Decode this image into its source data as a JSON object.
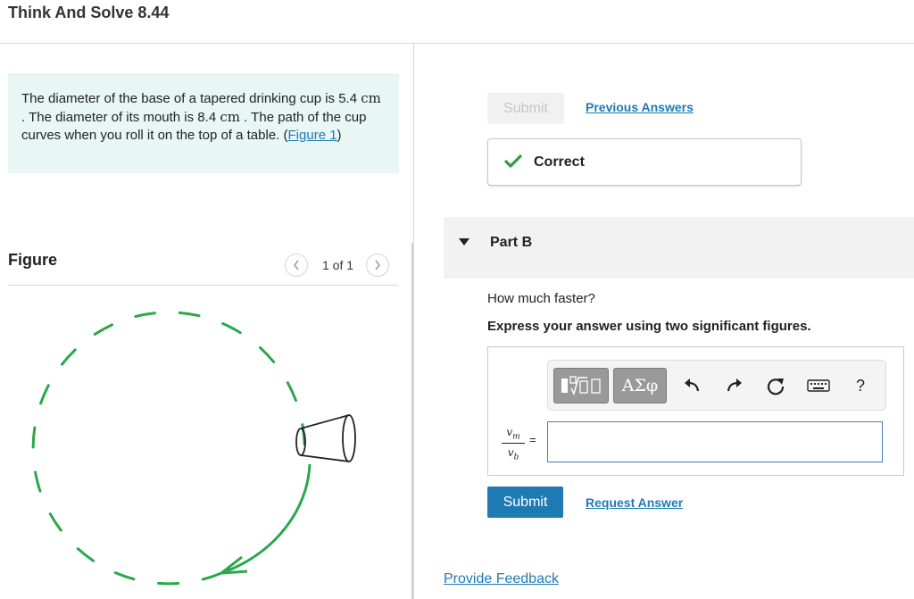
{
  "header": {
    "title": "Think And Solve 8.44"
  },
  "problem": {
    "text_1": "The diameter of the base of a tapered drinking cup is 5.4 ",
    "unit_1": "cm",
    "text_2": " . The diameter of its mouth is 8.4 ",
    "unit_2": "cm",
    "text_3": " . The path of the cup curves when you roll it on the top of a table. ",
    "figure_link_open": "(",
    "figure_link": "Figure 1",
    "figure_link_close": ")"
  },
  "figure": {
    "title": "Figure",
    "pager_text": "1 of 1",
    "prev_icon": "chevron-left-icon",
    "next_icon": "chevron-right-icon",
    "path_color": "#2aa84a"
  },
  "part_a": {
    "submit_label": "Submit",
    "previous_answers": "Previous Answers",
    "status_text": "Correct",
    "status_color": "#2e9e3a"
  },
  "part_b": {
    "title": "Part B",
    "question": "How much faster?",
    "instruction": "Express your answer using two significant figures.",
    "toolbar": {
      "templates_icon": "templates-icon",
      "greek_label": "ΑΣφ",
      "undo_icon": "undo-icon",
      "redo_icon": "redo-icon",
      "reset_icon": "reset-icon",
      "keyboard_icon": "keyboard-icon",
      "help_label": "?"
    },
    "fraction_numerator": "v",
    "fraction_numerator_sub": "m",
    "fraction_denominator": "v",
    "fraction_denominator_sub": "b",
    "equals": "=",
    "answer_value": "",
    "submit_label": "Submit",
    "request_answer": "Request Answer"
  },
  "footer": {
    "provide_feedback": "Provide Feedback"
  },
  "colors": {
    "accent": "#1f7ab4",
    "info_bg": "#e8f6f6"
  }
}
